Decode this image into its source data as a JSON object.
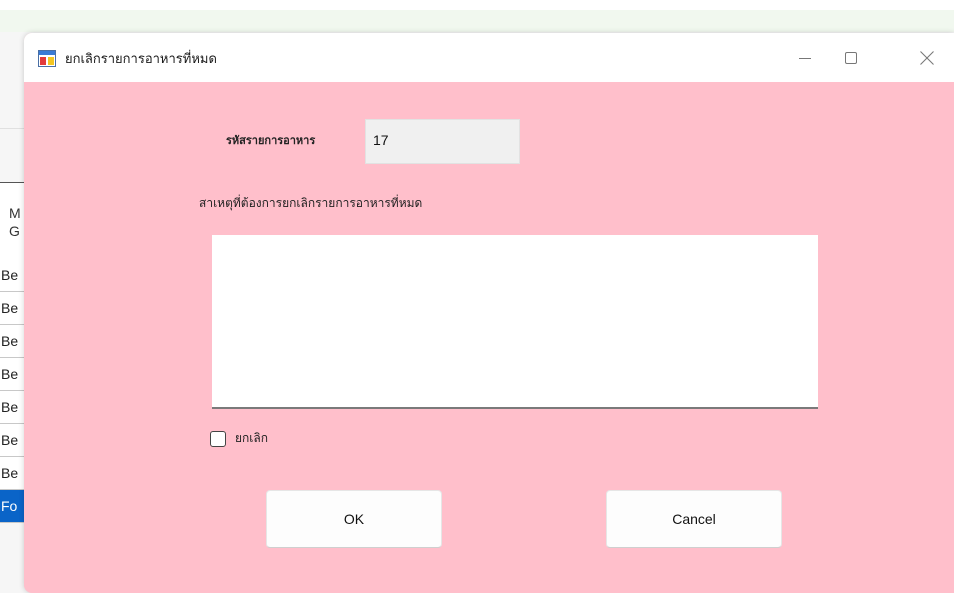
{
  "background_app": {
    "column_header": [
      "M",
      "G"
    ],
    "rows": [
      "Be",
      "Be",
      "Be",
      "Be",
      "Be",
      "Be",
      "Be"
    ],
    "selected_row": "Fo"
  },
  "dialog": {
    "title": "ยกเลิกรายการอาหารที่หมด",
    "window_controls": {
      "minimize_icon": "minimize-icon",
      "maximize_icon": "maximize-icon",
      "close_icon": "close-icon"
    },
    "fields": {
      "code_label": "รหัสรายการอาหาร",
      "code_value": "17",
      "reason_label": "สาเหตุที่ต้องการยกเลิกรายการอาหารที่หมด",
      "reason_value": "",
      "cancel_checkbox_label": "ยกเลิก",
      "cancel_checked": false
    },
    "buttons": {
      "ok_label": "OK",
      "cancel_label": "Cancel"
    },
    "colors": {
      "dialog_background": "#ffbfcb",
      "selected_row": "#0a64c8"
    }
  }
}
